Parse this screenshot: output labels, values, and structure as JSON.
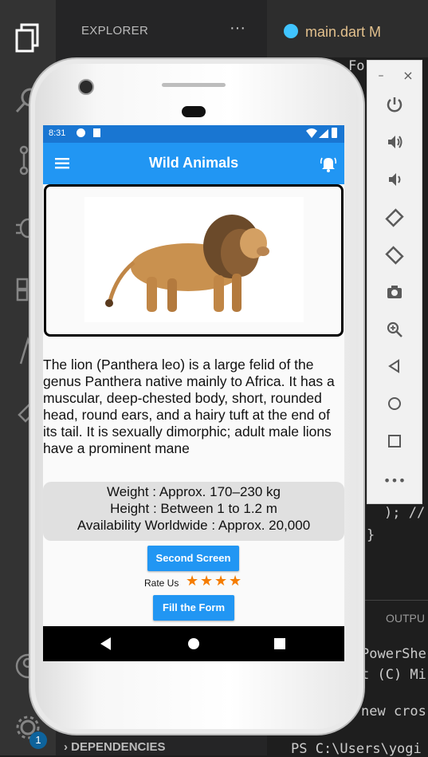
{
  "vscode": {
    "explorer_title": "EXPLORER",
    "explorer_more": "···",
    "dependencies": "DEPENDENCIES",
    "tab": {
      "label": "main.dart M"
    },
    "notification_count": "1",
    "editor_lines": [
      "); //",
      "}"
    ],
    "panel": {
      "title": "OUTPU",
      "lines": [
        "PowerShe",
        "t (C) Mi",
        "new cros",
        "PS C:\\Users\\yogi"
      ]
    },
    "editor_partial_tab": "Fo"
  },
  "emulator": {
    "window_controls": {
      "minimize": "–",
      "close": "×"
    },
    "tools": [
      "power-icon",
      "volume-up-icon",
      "volume-down-icon",
      "rotate-left-icon",
      "rotate-right-icon",
      "camera-icon",
      "zoom-icon",
      "back-icon",
      "home-icon",
      "overview-icon",
      "more-icon"
    ]
  },
  "phone": {
    "status_bar": {
      "time": "8:31"
    },
    "app_bar": {
      "title": "Wild Animals"
    },
    "description": "The lion (Panthera leo) is a large felid of the genus Panthera native mainly to Africa. It has a muscular, deep-chested body, short, rounded head, round ears, and a hairy tuft at the end of its tail. It is sexually dimorphic; adult male lions have a prominent mane",
    "info": {
      "weight": "Weight : Approx. 170–230 kg",
      "height": "Height : Between 1 to 1.2 m",
      "availability": "Availability Worldwide : Approx. 20,000"
    },
    "second_screen_button": "Second Screen",
    "rate_label": "Rate Us",
    "rating": 4,
    "fill_form_button": "Fill the Form"
  },
  "colors": {
    "app_bar": "#2196f3",
    "status_bar": "#1976d2",
    "star": "#f57c00"
  }
}
